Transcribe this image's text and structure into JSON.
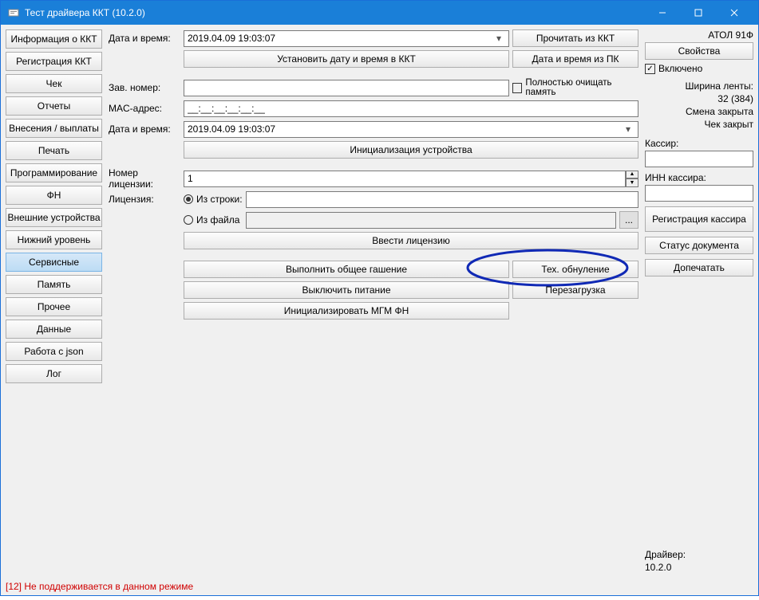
{
  "window": {
    "title": "Тест драйвера ККТ (10.2.0)"
  },
  "nav": {
    "items": [
      "Информация о ККТ",
      "Регистрация ККТ",
      "Чек",
      "Отчеты",
      "Внесения / выплаты",
      "Печать",
      "Программирование",
      "ФН",
      "Внешние устройства",
      "Нижний уровень",
      "Сервисные",
      "Память",
      "Прочее",
      "Данные",
      "Работа с json",
      "Лог"
    ],
    "active_index": 10
  },
  "center": {
    "datetime_label": "Дата и время:",
    "datetime_value": "2019.04.09 19:03:07",
    "read_kkt": "Прочитать из ККТ",
    "set_datetime": "Установить дату и время в ККТ",
    "datetime_from_pc": "Дата и время из ПК",
    "serial_label": "Зав. номер:",
    "serial_value": "",
    "clear_memory_label": "Полностью очищать память",
    "mac_label": "MAC-адрес:",
    "mac_value": "__:__:__:__:__:__",
    "datetime2_value": "2019.04.09 19:03:07",
    "init_device": "Инициализация устройства",
    "license_no_label": "Номер лицензии:",
    "license_no_value": "1",
    "license_label": "Лицензия:",
    "from_string": "Из строки:",
    "from_file": "Из файла",
    "browse": "...",
    "enter_license": "Ввести лицензию",
    "general_reset": "Выполнить общее гашение",
    "tech_reset": "Тех. обнуление",
    "power_off": "Выключить питание",
    "reboot": "Перезагрузка",
    "init_mgm": "Инициализировать МГМ ФН"
  },
  "right": {
    "device": "АТОЛ 91Ф",
    "properties": "Свойства",
    "enabled": "Включено",
    "tape_width_label": "Ширина ленты:",
    "tape_width_value": "32 (384)",
    "shift_status": "Смена закрыта",
    "check_status": "Чек закрыт",
    "cashier_label": "Кассир:",
    "cashier_value": "",
    "inn_label": "ИНН кассира:",
    "inn_value": "",
    "register_cashier": "Регистрация кассира",
    "doc_status": "Статус документа",
    "reprint": "Допечатать",
    "driver_label": "Драйвер:",
    "driver_version": "10.2.0"
  },
  "status": {
    "message": "[12] Не поддерживается в данном режиме"
  }
}
